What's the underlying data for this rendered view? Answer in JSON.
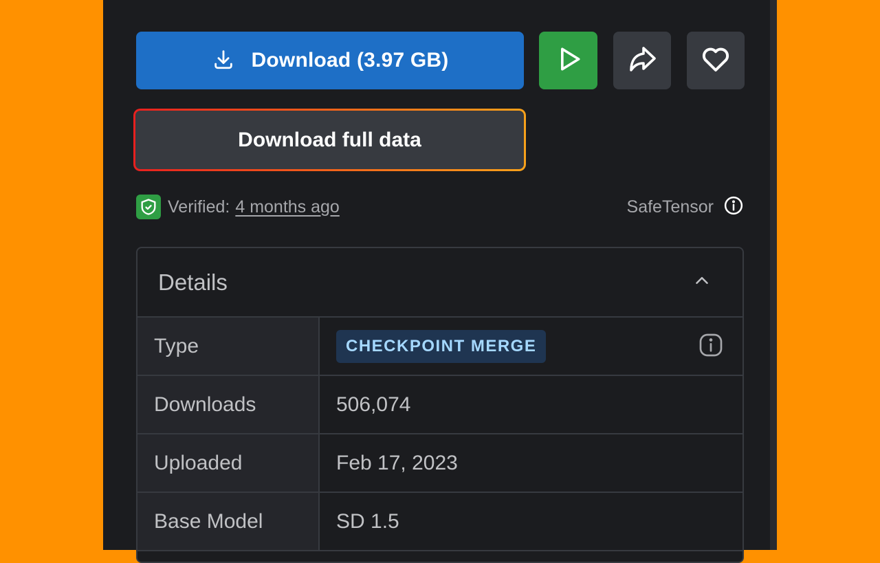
{
  "actions": {
    "download_label": "Download (3.97 GB)",
    "full_data_label": "Download full data",
    "colors": {
      "download": "#1E6FC6",
      "run": "#2F9E44",
      "secondary": "#373A40"
    }
  },
  "verification": {
    "prefix": "Verified:",
    "age": "4 months ago",
    "format": "SafeTensor"
  },
  "details": {
    "title": "Details",
    "rows": [
      {
        "key": "Type",
        "value": "CHECKPOINT MERGE"
      },
      {
        "key": "Downloads",
        "value": "506,074"
      },
      {
        "key": "Uploaded",
        "value": "Feb 17, 2023"
      },
      {
        "key": "Base Model",
        "value": "SD 1.5"
      }
    ]
  },
  "icons": [
    "download-icon",
    "play-icon",
    "share-icon",
    "heart-icon",
    "shield-check-icon",
    "info-icon",
    "chevron-up-icon"
  ]
}
